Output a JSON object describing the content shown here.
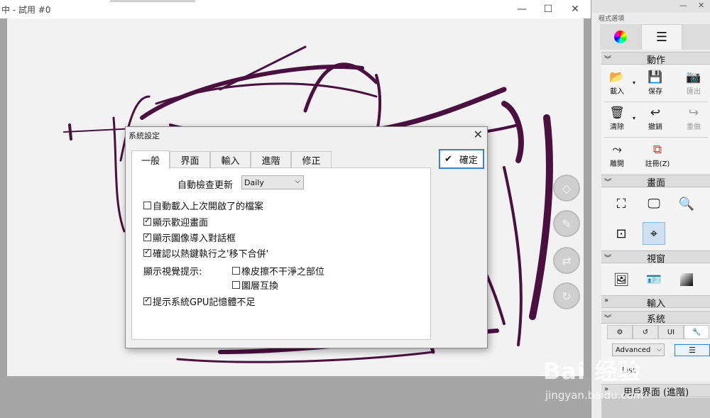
{
  "window": {
    "title": "中 - 試用 #0",
    "minimize": "—",
    "maximize": "☐",
    "close": "✕"
  },
  "dialog": {
    "title": "系統設定",
    "close": "✕",
    "tabs": [
      "一般",
      "界面",
      "輸入",
      "進階",
      "修正"
    ],
    "active_tab": "一般",
    "update_label": "自動檢查更新",
    "update_value": "Daily",
    "options": [
      {
        "label": "自動載入上次開啟了的檔案",
        "checked": false
      },
      {
        "label": "顯示歡迎畫面",
        "checked": true
      },
      {
        "label": "顯示圖像導入對話框",
        "checked": true
      },
      {
        "label": "確認以熱鍵執行之'移下合併'",
        "checked": true
      }
    ],
    "visual_hints_label": "顯示視覺提示:",
    "visual_hints": [
      {
        "label": "橡皮擦不干淨之部位",
        "checked": false
      },
      {
        "label": "圖層互換",
        "checked": false
      }
    ],
    "gpu_warning": {
      "label": "提示系統GPU記憶體不足",
      "checked": true
    },
    "ok_label": "確定"
  },
  "panel": {
    "title": "程式選項",
    "sections": {
      "actions": "動作",
      "canvas": "畫面",
      "view": "視窗",
      "input": "輸入",
      "system": "系統",
      "ui": "用戶界面 (進階)"
    },
    "action_buttons": [
      {
        "label": "載入",
        "icon": "open-folder-icon"
      },
      {
        "label": "保存",
        "icon": "save-icon"
      },
      {
        "label": "匯出",
        "icon": "camera-icon"
      },
      {
        "label": "清除",
        "icon": "trash-icon"
      },
      {
        "label": "撤銷",
        "icon": "undo-icon"
      },
      {
        "label": "重做",
        "icon": "redo-icon"
      },
      {
        "label": "離開",
        "icon": "exit-icon"
      },
      {
        "label": "註冊(Z)",
        "icon": "register-icon"
      }
    ],
    "system_tabs": [
      "",
      "",
      "UI",
      ""
    ],
    "advanced_value": "Advanced",
    "list_label": "List"
  },
  "watermark": {
    "text": "Bai 经验",
    "url": "jingyan.baidu.com"
  },
  "colors": {
    "accent": "#3a7fd0",
    "stroke": "#4a1040"
  }
}
